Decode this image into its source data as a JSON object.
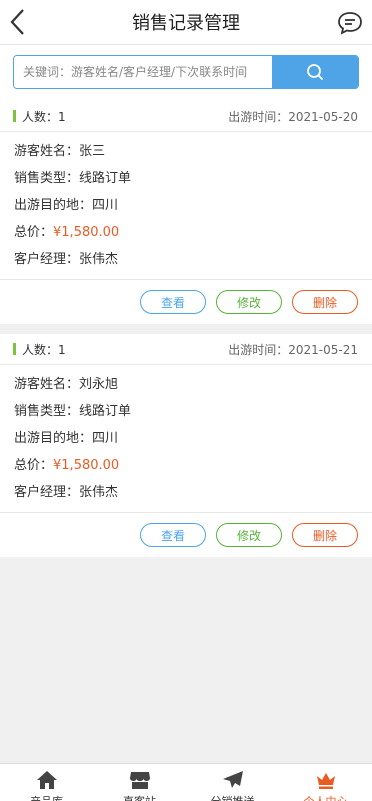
{
  "header": {
    "title": "销售记录管理"
  },
  "search": {
    "placeholder": "关键词：游客姓名/客户经理/下次联系时间"
  },
  "records": [
    {
      "count_label": "人数：1",
      "date_label": "出游时间：2021-05-20",
      "name_label": "游客姓名：张三",
      "type_label": "销售类型：线路订单",
      "dest_label": "出游目的地：四川",
      "price_prefix": "总价：",
      "price": "¥1,580.00",
      "manager_label": "客户经理：张伟杰",
      "view": "查看",
      "edit": "修改",
      "delete": "删除"
    },
    {
      "count_label": "人数：1",
      "date_label": "出游时间：2021-05-21",
      "name_label": "游客姓名：刘永旭",
      "type_label": "销售类型：线路订单",
      "dest_label": "出游目的地：四川",
      "price_prefix": "总价：",
      "price": "¥1,580.00",
      "manager_label": "客户经理：张伟杰",
      "view": "查看",
      "edit": "修改",
      "delete": "删除"
    }
  ],
  "tabbar": {
    "items": [
      {
        "label": "产品库",
        "icon": "home-icon"
      },
      {
        "label": "直客站",
        "icon": "store-icon"
      },
      {
        "label": "分销推送",
        "icon": "send-icon"
      },
      {
        "label": "个人中心",
        "icon": "crown-icon"
      }
    ],
    "active_color": "#ea5b23"
  },
  "colors": {
    "accent": "#4ea4e6",
    "price": "#ea5b23",
    "edit": "#59b23a",
    "count_bar": "#7cc241"
  }
}
